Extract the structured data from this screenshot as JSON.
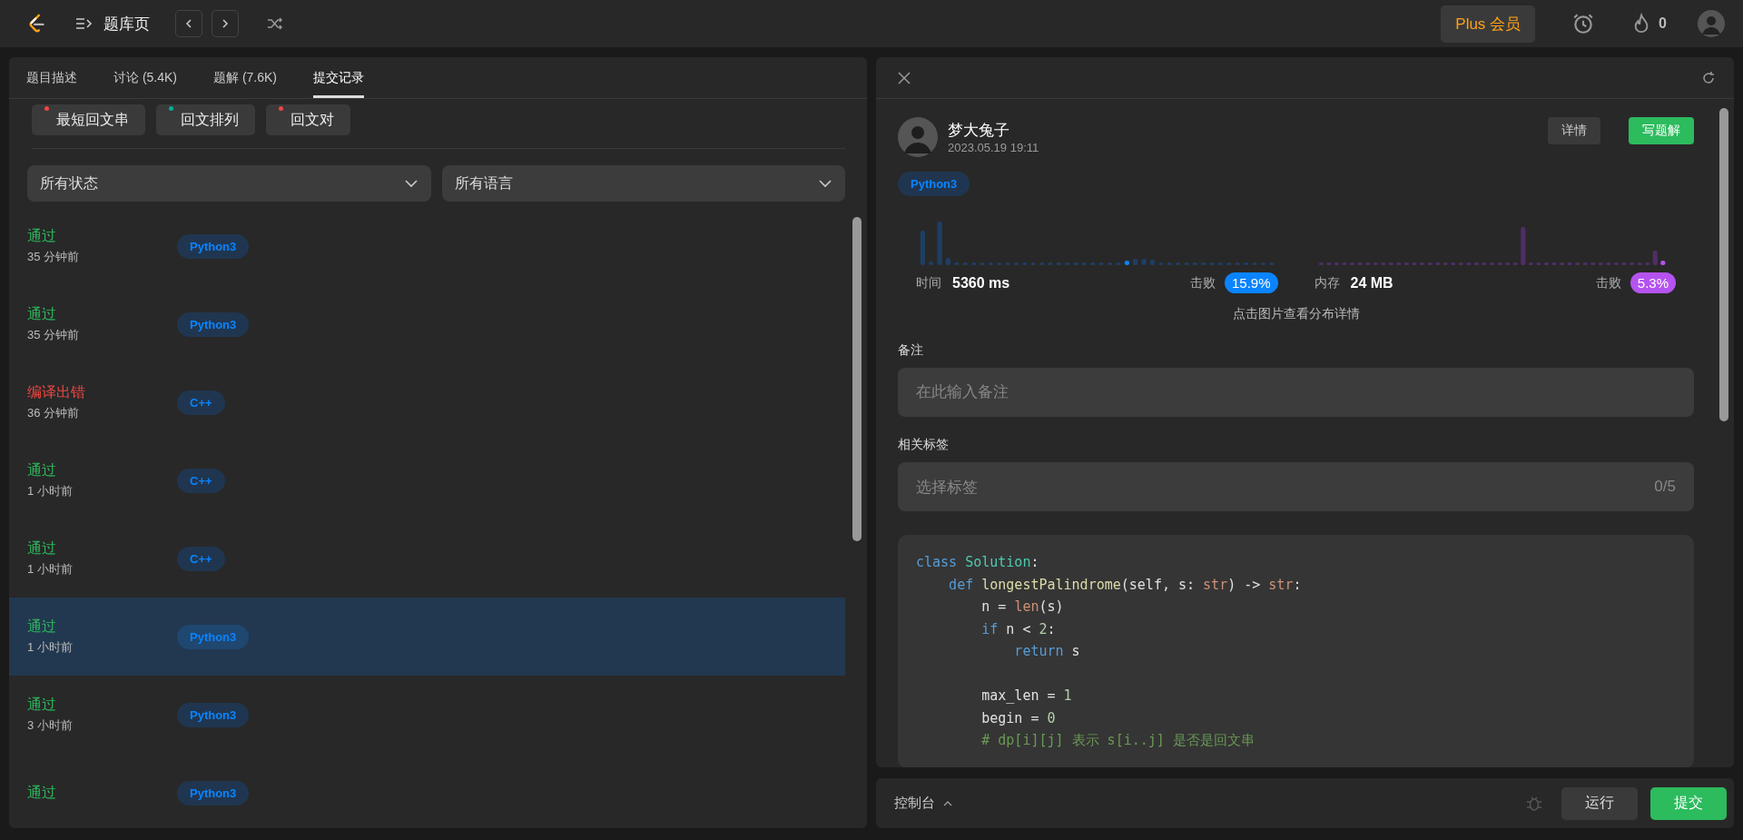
{
  "topbar": {
    "title": "题库页",
    "plus": "Plus 会员",
    "streak": "0"
  },
  "left": {
    "tabs": [
      {
        "label": "题目描述",
        "selected": false
      },
      {
        "label": "讨论 (5.4K)",
        "selected": false
      },
      {
        "label": "题解 (7.6K)",
        "selected": false
      },
      {
        "label": "提交记录",
        "selected": true
      }
    ],
    "related": [
      {
        "label": "最短回文串",
        "color": "#ef4743"
      },
      {
        "label": "回文排列",
        "color": "#00af9b"
      },
      {
        "label": "回文对",
        "color": "#ef4743"
      }
    ],
    "filters": [
      {
        "value": "所有状态"
      },
      {
        "value": "所有语言"
      }
    ],
    "submissions": [
      {
        "status": "通过",
        "kind": "pass",
        "time": "35 分钟前",
        "lang": "Python3",
        "selected": false
      },
      {
        "status": "通过",
        "kind": "pass",
        "time": "35 分钟前",
        "lang": "Python3",
        "selected": false
      },
      {
        "status": "编译出错",
        "kind": "fail",
        "time": "36 分钟前",
        "lang": "C++",
        "selected": false
      },
      {
        "status": "通过",
        "kind": "pass",
        "time": "1 小时前",
        "lang": "C++",
        "selected": false
      },
      {
        "status": "通过",
        "kind": "pass",
        "time": "1 小时前",
        "lang": "C++",
        "selected": false
      },
      {
        "status": "通过",
        "kind": "pass",
        "time": "1 小时前",
        "lang": "Python3",
        "selected": true
      },
      {
        "status": "通过",
        "kind": "pass",
        "time": "3 小时前",
        "lang": "Python3",
        "selected": false
      },
      {
        "status": "通过",
        "kind": "pass",
        "lang": "Python3",
        "selected": false
      }
    ]
  },
  "detail": {
    "user": "梦大兔子",
    "date": "2023.05.19 19:11",
    "buttons": [
      "详情",
      "写题解"
    ],
    "lang": "Python3",
    "stats": [
      {
        "kind": "time",
        "label": "时间",
        "value": "5360 ms",
        "beat_label": "击败",
        "beat": "15.9%"
      },
      {
        "kind": "memory",
        "label": "内存",
        "value": "24 MB",
        "beat_label": "击败",
        "beat": "5.3%"
      }
    ],
    "chart_hint": "点击图片查看分布详情",
    "note_label": "备注",
    "note_placeholder": "在此输入备注",
    "tags_label": "相关标签",
    "tags_placeholder": "选择标签",
    "tags_count": "0/5",
    "code": [
      {
        "tokens": [
          {
            "kind": "keyword",
            "text": "class "
          },
          {
            "kind": "classname",
            "text": "Solution"
          },
          {
            "kind": "plain",
            "text": ":"
          }
        ]
      },
      {
        "tokens": [
          {
            "kind": "keyword",
            "text": "    def "
          },
          {
            "kind": "function",
            "text": "longestPalindrome"
          },
          {
            "kind": "plain",
            "text": "(self, s: "
          },
          {
            "kind": "builtin",
            "text": "str"
          },
          {
            "kind": "plain",
            "text": ") -> "
          },
          {
            "kind": "builtin",
            "text": "str"
          },
          {
            "kind": "plain",
            "text": ":"
          }
        ]
      },
      {
        "tokens": [
          {
            "kind": "plain",
            "text": "        n = "
          },
          {
            "kind": "builtin",
            "text": "len"
          },
          {
            "kind": "plain",
            "text": "(s)"
          }
        ]
      },
      {
        "tokens": [
          {
            "kind": "keyword",
            "text": "        if"
          },
          {
            "kind": "plain",
            "text": " n < "
          },
          {
            "kind": "number",
            "text": "2"
          },
          {
            "kind": "plain",
            "text": ":"
          }
        ]
      },
      {
        "tokens": [
          {
            "kind": "keyword",
            "text": "            return"
          },
          {
            "kind": "plain",
            "text": " s"
          }
        ]
      },
      {
        "blank_before": true,
        "tokens": [
          {
            "kind": "plain",
            "text": "        max_len = "
          },
          {
            "kind": "number",
            "text": "1"
          }
        ]
      },
      {
        "tokens": [
          {
            "kind": "plain",
            "text": "        begin = "
          },
          {
            "kind": "number",
            "text": "0"
          }
        ]
      },
      {
        "tokens": [
          {
            "kind": "comment",
            "text": "        # dp[i][j] 表示 s[i..j] 是否是回文串"
          }
        ]
      }
    ]
  },
  "console": {
    "label": "控制台",
    "run": "运行",
    "submit": "提交"
  }
}
